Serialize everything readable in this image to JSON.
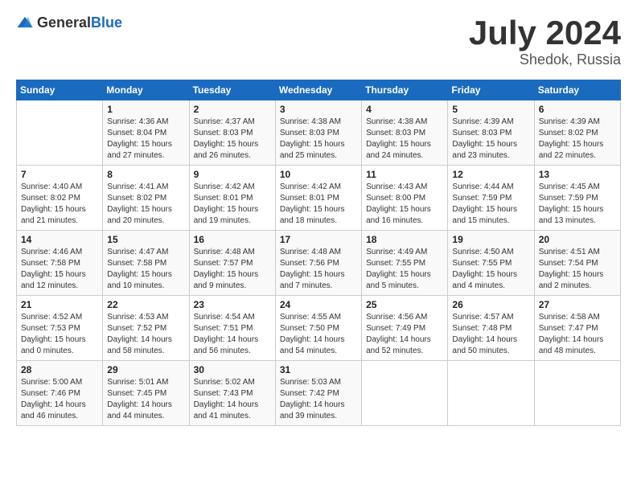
{
  "header": {
    "logo_general": "General",
    "logo_blue": "Blue",
    "title": "July 2024",
    "subtitle": "Shedok, Russia"
  },
  "weekdays": [
    "Sunday",
    "Monday",
    "Tuesday",
    "Wednesday",
    "Thursday",
    "Friday",
    "Saturday"
  ],
  "weeks": [
    [
      {
        "day": "",
        "info": ""
      },
      {
        "day": "1",
        "info": "Sunrise: 4:36 AM\nSunset: 8:04 PM\nDaylight: 15 hours\nand 27 minutes."
      },
      {
        "day": "2",
        "info": "Sunrise: 4:37 AM\nSunset: 8:03 PM\nDaylight: 15 hours\nand 26 minutes."
      },
      {
        "day": "3",
        "info": "Sunrise: 4:38 AM\nSunset: 8:03 PM\nDaylight: 15 hours\nand 25 minutes."
      },
      {
        "day": "4",
        "info": "Sunrise: 4:38 AM\nSunset: 8:03 PM\nDaylight: 15 hours\nand 24 minutes."
      },
      {
        "day": "5",
        "info": "Sunrise: 4:39 AM\nSunset: 8:03 PM\nDaylight: 15 hours\nand 23 minutes."
      },
      {
        "day": "6",
        "info": "Sunrise: 4:39 AM\nSunset: 8:02 PM\nDaylight: 15 hours\nand 22 minutes."
      }
    ],
    [
      {
        "day": "7",
        "info": "Sunrise: 4:40 AM\nSunset: 8:02 PM\nDaylight: 15 hours\nand 21 minutes."
      },
      {
        "day": "8",
        "info": "Sunrise: 4:41 AM\nSunset: 8:02 PM\nDaylight: 15 hours\nand 20 minutes."
      },
      {
        "day": "9",
        "info": "Sunrise: 4:42 AM\nSunset: 8:01 PM\nDaylight: 15 hours\nand 19 minutes."
      },
      {
        "day": "10",
        "info": "Sunrise: 4:42 AM\nSunset: 8:01 PM\nDaylight: 15 hours\nand 18 minutes."
      },
      {
        "day": "11",
        "info": "Sunrise: 4:43 AM\nSunset: 8:00 PM\nDaylight: 15 hours\nand 16 minutes."
      },
      {
        "day": "12",
        "info": "Sunrise: 4:44 AM\nSunset: 7:59 PM\nDaylight: 15 hours\nand 15 minutes."
      },
      {
        "day": "13",
        "info": "Sunrise: 4:45 AM\nSunset: 7:59 PM\nDaylight: 15 hours\nand 13 minutes."
      }
    ],
    [
      {
        "day": "14",
        "info": "Sunrise: 4:46 AM\nSunset: 7:58 PM\nDaylight: 15 hours\nand 12 minutes."
      },
      {
        "day": "15",
        "info": "Sunrise: 4:47 AM\nSunset: 7:58 PM\nDaylight: 15 hours\nand 10 minutes."
      },
      {
        "day": "16",
        "info": "Sunrise: 4:48 AM\nSunset: 7:57 PM\nDaylight: 15 hours\nand 9 minutes."
      },
      {
        "day": "17",
        "info": "Sunrise: 4:48 AM\nSunset: 7:56 PM\nDaylight: 15 hours\nand 7 minutes."
      },
      {
        "day": "18",
        "info": "Sunrise: 4:49 AM\nSunset: 7:55 PM\nDaylight: 15 hours\nand 5 minutes."
      },
      {
        "day": "19",
        "info": "Sunrise: 4:50 AM\nSunset: 7:55 PM\nDaylight: 15 hours\nand 4 minutes."
      },
      {
        "day": "20",
        "info": "Sunrise: 4:51 AM\nSunset: 7:54 PM\nDaylight: 15 hours\nand 2 minutes."
      }
    ],
    [
      {
        "day": "21",
        "info": "Sunrise: 4:52 AM\nSunset: 7:53 PM\nDaylight: 15 hours\nand 0 minutes."
      },
      {
        "day": "22",
        "info": "Sunrise: 4:53 AM\nSunset: 7:52 PM\nDaylight: 14 hours\nand 58 minutes."
      },
      {
        "day": "23",
        "info": "Sunrise: 4:54 AM\nSunset: 7:51 PM\nDaylight: 14 hours\nand 56 minutes."
      },
      {
        "day": "24",
        "info": "Sunrise: 4:55 AM\nSunset: 7:50 PM\nDaylight: 14 hours\nand 54 minutes."
      },
      {
        "day": "25",
        "info": "Sunrise: 4:56 AM\nSunset: 7:49 PM\nDaylight: 14 hours\nand 52 minutes."
      },
      {
        "day": "26",
        "info": "Sunrise: 4:57 AM\nSunset: 7:48 PM\nDaylight: 14 hours\nand 50 minutes."
      },
      {
        "day": "27",
        "info": "Sunrise: 4:58 AM\nSunset: 7:47 PM\nDaylight: 14 hours\nand 48 minutes."
      }
    ],
    [
      {
        "day": "28",
        "info": "Sunrise: 5:00 AM\nSunset: 7:46 PM\nDaylight: 14 hours\nand 46 minutes."
      },
      {
        "day": "29",
        "info": "Sunrise: 5:01 AM\nSunset: 7:45 PM\nDaylight: 14 hours\nand 44 minutes."
      },
      {
        "day": "30",
        "info": "Sunrise: 5:02 AM\nSunset: 7:43 PM\nDaylight: 14 hours\nand 41 minutes."
      },
      {
        "day": "31",
        "info": "Sunrise: 5:03 AM\nSunset: 7:42 PM\nDaylight: 14 hours\nand 39 minutes."
      },
      {
        "day": "",
        "info": ""
      },
      {
        "day": "",
        "info": ""
      },
      {
        "day": "",
        "info": ""
      }
    ]
  ]
}
